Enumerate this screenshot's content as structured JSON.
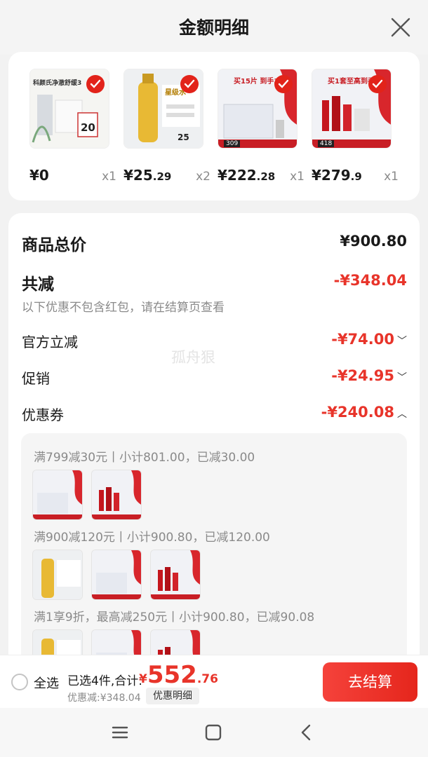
{
  "header": {
    "title": "金额明细"
  },
  "products": [
    {
      "int": "¥0",
      "dec": "",
      "qty": "x1",
      "label": "科颜氏净澈舒缓3",
      "badge": "20"
    },
    {
      "int": "¥25",
      "dec": ".29",
      "qty": "x2",
      "label": "星级水",
      "badge": "25"
    },
    {
      "int": "¥222",
      "dec": ".28",
      "qty": "x1",
      "label": "买15片 到手32片",
      "badge": "309"
    },
    {
      "int": "¥279",
      "dec": ".9",
      "qty": "x1",
      "label": "买1套至高到手11",
      "badge": "418"
    }
  ],
  "summary": {
    "total_label": "商品总价",
    "total_value": "¥900.80",
    "reduce_label": "共减",
    "reduce_value": "-¥348.04",
    "note": "以下优惠不包含红包，请在结算页查看",
    "items": [
      {
        "label": "官方立减",
        "value": "-¥74.00",
        "chev": "﹀"
      },
      {
        "label": "促销",
        "value": "-¥24.95",
        "chev": "﹀"
      },
      {
        "label": "优惠券",
        "value": "-¥240.08",
        "chev": "︿"
      }
    ]
  },
  "coupons": [
    {
      "rule": "满799减30元丨小计801.00，已减30.00"
    },
    {
      "rule": "满900减120元丨小计900.80，已减120.00"
    },
    {
      "rule": "满1享9折，最高减250元丨小计900.80，已减90.08"
    }
  ],
  "watermark": "孤舟狠",
  "bottom": {
    "select_all": "全选",
    "selected_text": "已选4件,合计:",
    "currency": "¥",
    "total_int": "552",
    "total_dec": ".76",
    "discount_text": "优惠减:¥348.04",
    "detail_button": "优惠明细",
    "checkout_button": "去结算"
  },
  "colors": {
    "accent": "#e8342a",
    "checkout_start": "#f5423b",
    "checkout_end": "#e5261c"
  },
  "icons": [
    "close-icon",
    "check-icon",
    "menu-icon",
    "home-icon",
    "back-icon"
  ]
}
